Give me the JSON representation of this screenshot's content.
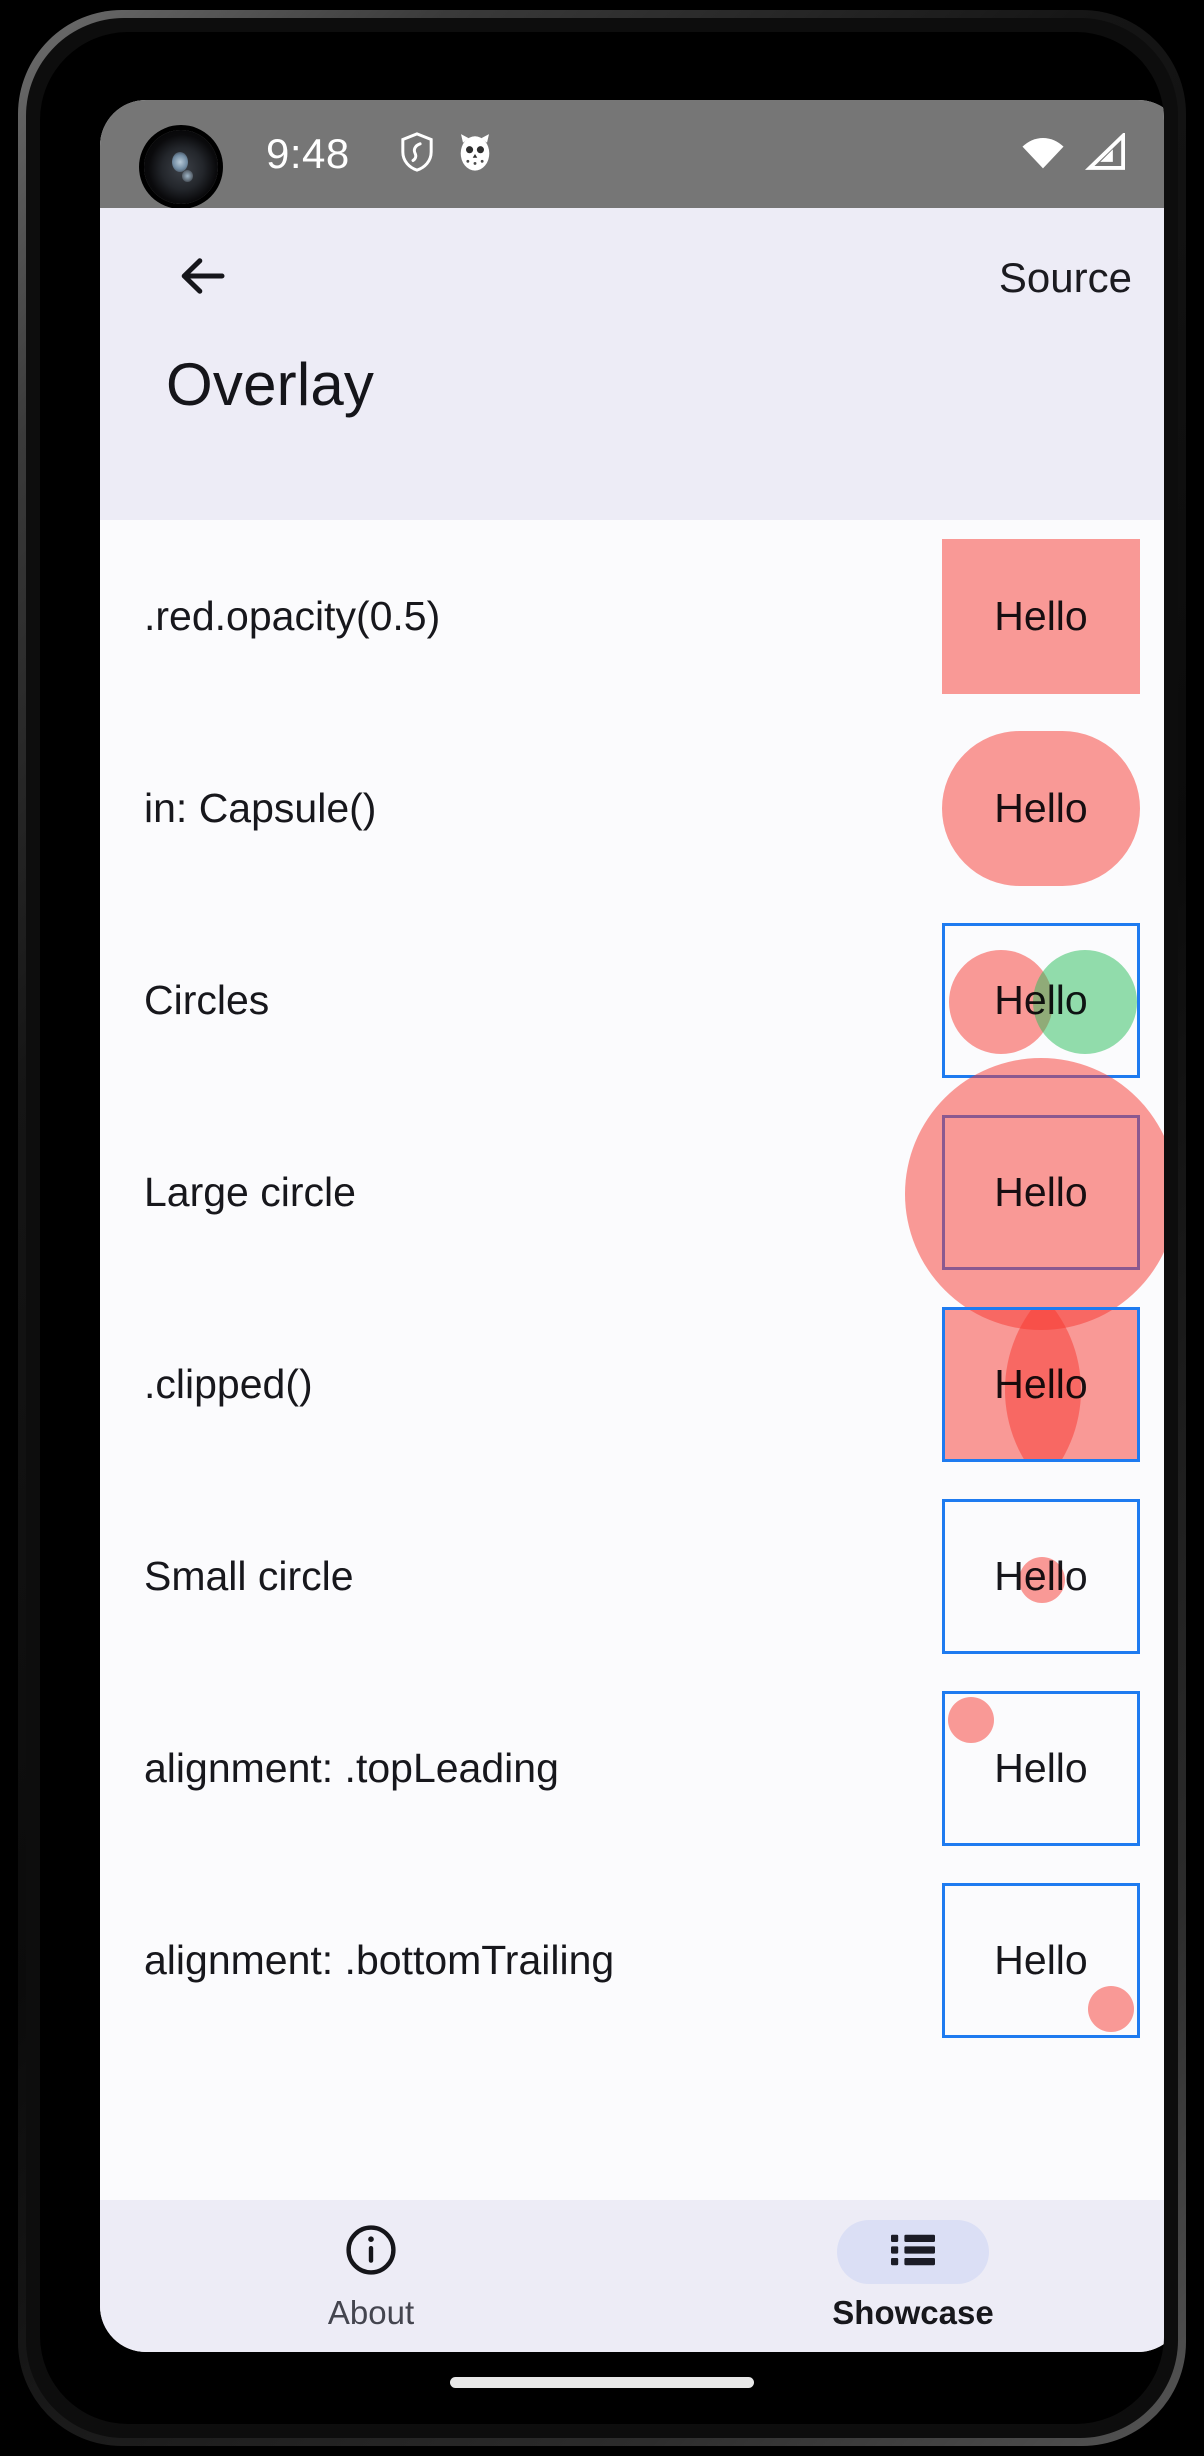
{
  "statusbar": {
    "time": "9:48",
    "icons": [
      "shield-icon",
      "owl-icon"
    ],
    "right_icons": [
      "wifi-icon",
      "cell-signal-icon"
    ],
    "bg_color": "#767676"
  },
  "appbar": {
    "back_icon": "arrow-left-icon",
    "action_label": "Source",
    "title": "Overlay",
    "bg_color": "#edecf6"
  },
  "list": {
    "hello_text": "Hello",
    "accent_red": "#f83830",
    "accent_green": "#28be5a",
    "box_stroke": "#1e7bf0",
    "rows": [
      {
        "label": ".red.opacity(0.5)",
        "demo": "rect-red"
      },
      {
        "label": "in: Capsule()",
        "demo": "capsule-red"
      },
      {
        "label": "Circles",
        "demo": "two-circles"
      },
      {
        "label": "Large circle",
        "demo": "large-circle"
      },
      {
        "label": ".clipped()",
        "demo": "clipped-circles"
      },
      {
        "label": "Small circle",
        "demo": "small-circle"
      },
      {
        "label": "alignment: .topLeading",
        "demo": "align-top-leading"
      },
      {
        "label": "alignment: .bottomTrailing",
        "demo": "align-bottom-trailing"
      }
    ]
  },
  "bottomnav": {
    "items": [
      {
        "label": "About",
        "icon": "info-circle-icon",
        "active": false
      },
      {
        "label": "Showcase",
        "icon": "list-bullet-icon",
        "active": true
      }
    ],
    "bg_color": "#edecf6",
    "pill_color": "#dbdff5"
  }
}
